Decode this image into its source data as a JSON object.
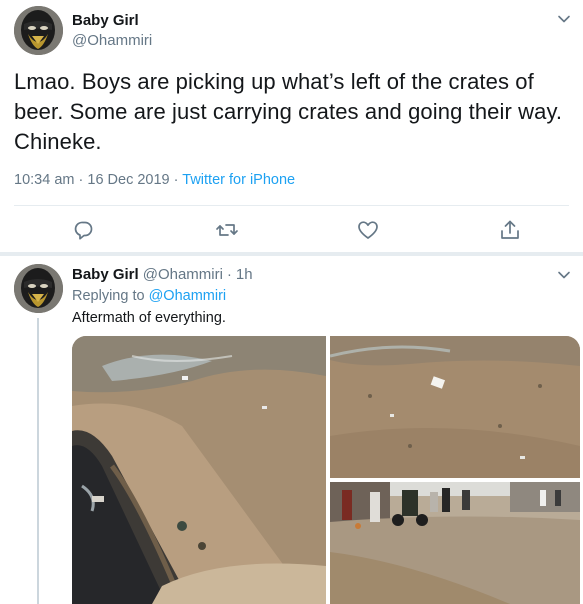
{
  "main_tweet": {
    "author": {
      "display_name": "Baby Girl",
      "handle": "@Ohammiri"
    },
    "text": "Lmao. Boys are picking up what’s left of the crates of beer. Some are just carrying crates and going their way. Chineke.",
    "time": "10:34 am",
    "separator": "·",
    "date": "16 Dec 2019",
    "source": "Twitter for iPhone"
  },
  "reply": {
    "author": {
      "display_name": "Baby Girl",
      "handle": "@Ohammiri",
      "age": "1h"
    },
    "replying_label": "Replying to",
    "replying_to": "@Ohammiri",
    "text": "Aftermath of everything."
  },
  "icons": {
    "reply": "reply-icon",
    "retweet": "retweet-icon",
    "like": "heart-icon",
    "share": "share-icon",
    "more": "chevron-down-icon"
  },
  "colors": {
    "text": "#14171a",
    "secondary": "#657786",
    "link": "#1da1f2",
    "border": "#e6ecf0",
    "thread_line": "#ccd6dd"
  }
}
